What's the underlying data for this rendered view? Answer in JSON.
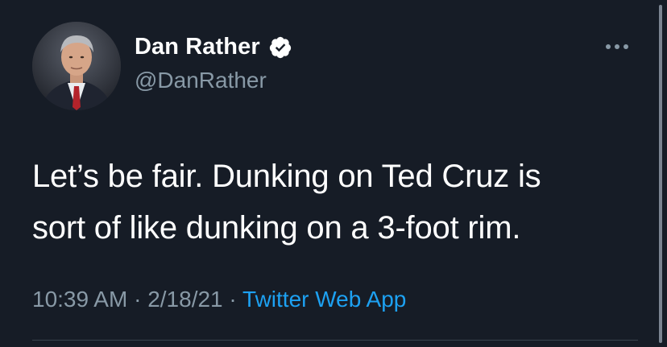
{
  "author": {
    "display_name": "Dan Rather",
    "handle": "@DanRather",
    "verified": true
  },
  "tweet": {
    "text_line1": "Let’s be fair. Dunking on Ted Cruz is",
    "text_line2": "sort of like dunking on a 3-foot rim."
  },
  "meta": {
    "time": "10:39 AM",
    "sep1": " · ",
    "date": "2/18/21",
    "sep2": " · ",
    "source": "Twitter Web App"
  },
  "icons": {
    "verified": "verified-badge-icon",
    "more": "more-options-icon"
  },
  "colors": {
    "background": "#161c26",
    "secondary_text": "#8899a6",
    "link": "#1da1f2",
    "divider": "#38444d"
  }
}
